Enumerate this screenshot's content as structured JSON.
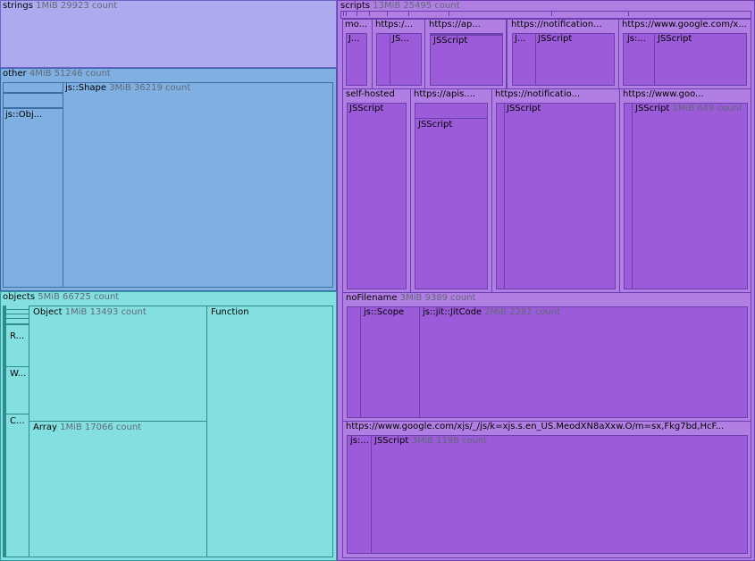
{
  "nodes": {
    "strings": {
      "name": "strings",
      "meta": "1MiB 29923 count"
    },
    "other": {
      "name": "other",
      "meta": "4MiB 51246 count"
    },
    "other_shape": {
      "name": "js::Shape",
      "meta": "3MiB 36219 count"
    },
    "other_obj": {
      "name": "js::Obj..."
    },
    "objects": {
      "name": "objects",
      "meta": "5MiB 66725 count"
    },
    "objects_object": {
      "name": "Object",
      "meta": "1MiB 13493 count"
    },
    "objects_function": {
      "name": "Function"
    },
    "objects_array": {
      "name": "Array",
      "meta": "1MiB 17066 count"
    },
    "objects_r": {
      "name": "R..."
    },
    "objects_w": {
      "name": "W..."
    },
    "objects_c": {
      "name": "C..."
    },
    "scripts": {
      "name": "scripts",
      "meta": "13MiB 25495 count"
    },
    "s_mo": {
      "name": "mo..."
    },
    "s_mo_j": {
      "name": "J..."
    },
    "s_https1": {
      "name": "https:/..."
    },
    "s_https1_js": {
      "name": "JS..."
    },
    "s_ap": {
      "name": "https://ap..."
    },
    "s_ap_js": {
      "name": "JSScript"
    },
    "s_notif1": {
      "name": "https://notification..."
    },
    "s_notif1_j": {
      "name": "J..."
    },
    "s_notif1_js": {
      "name": "JSScript"
    },
    "s_google1": {
      "name": "https://www.google.com/x..."
    },
    "s_google1_jsdots": {
      "name": "js:..."
    },
    "s_google1_js": {
      "name": "JSScript"
    },
    "s_self": {
      "name": "self-hosted"
    },
    "s_self_js": {
      "name": "JSScript"
    },
    "s_apis": {
      "name": "https://apis...."
    },
    "s_apis_js": {
      "name": "JSScript"
    },
    "s_notif2": {
      "name": "https://notificatio..."
    },
    "s_notif2_js": {
      "name": "JSScript"
    },
    "s_goo2": {
      "name": "https://www.goo..."
    },
    "s_goo2_js": {
      "name": "JSScript",
      "meta": "1MiB 649 count"
    },
    "s_nofile": {
      "name": "noFilename",
      "meta": "3MiB 9389 count"
    },
    "s_nofile_scope": {
      "name": "js::Scope"
    },
    "s_nofile_jit": {
      "name": "js::jit::JitCode",
      "meta": "2MiB 2282 count"
    },
    "s_xjs": {
      "name": "https://www.google.com/xjs/_/js/k=xjs.s.en_US.MeodXN8aXxw.O/m=sx,Fkg7bd,HcF..."
    },
    "s_xjs_jsdots": {
      "name": "js:..."
    },
    "s_xjs_js": {
      "name": "JSScript",
      "meta": "3MiB 1198 count"
    }
  }
}
